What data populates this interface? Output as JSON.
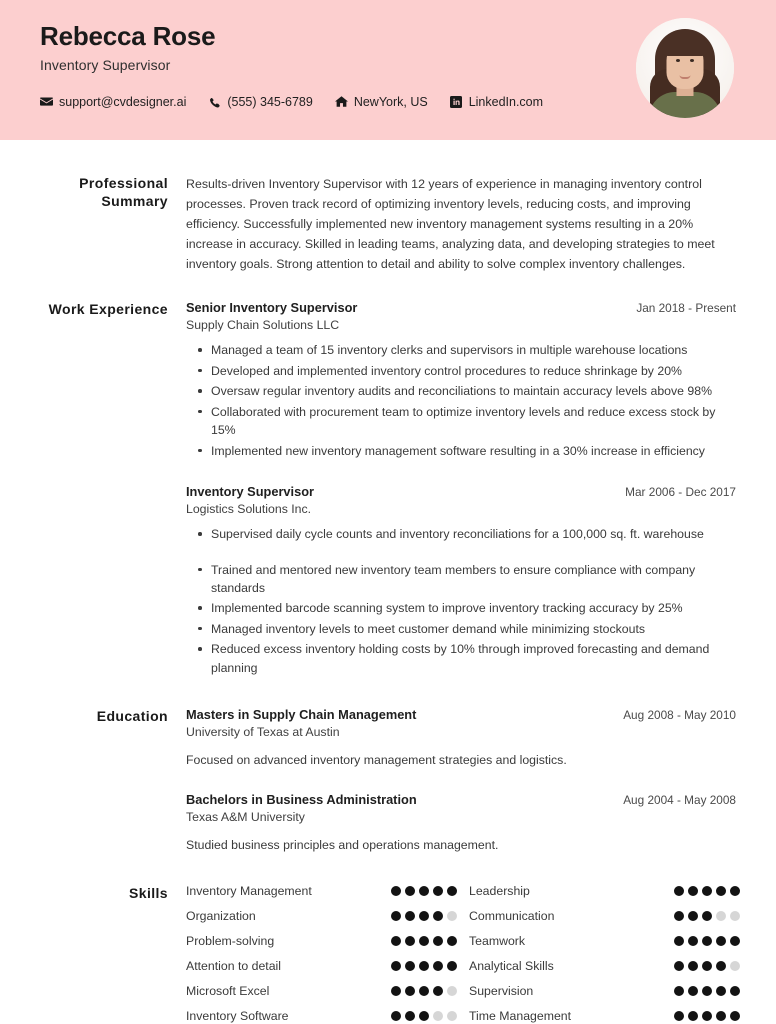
{
  "header": {
    "name": "Rebecca Rose",
    "job_title": "Inventory Supervisor",
    "background_color": "#FCCFCF",
    "avatar_alt": "profile-photo",
    "contacts": [
      {
        "icon": "envelope-icon",
        "text": "support@cvdesigner.ai"
      },
      {
        "icon": "phone-icon",
        "text": "(555) 345-6789"
      },
      {
        "icon": "home-icon",
        "text": "NewYork, US"
      },
      {
        "icon": "linkedin-icon",
        "text": "LinkedIn.com"
      }
    ]
  },
  "summary": {
    "label": "Professional Summary",
    "text": "Results-driven Inventory Supervisor with 12 years of experience in managing inventory control processes. Proven track record of optimizing inventory levels, reducing costs, and improving efficiency. Successfully implemented new inventory management systems resulting in a 20% increase in accuracy. Skilled in leading teams, analyzing data, and developing strategies to meet inventory goals. Strong attention to detail and ability to solve complex inventory challenges."
  },
  "experience": {
    "label": "Work Experience",
    "jobs": [
      {
        "role": "Senior Inventory Supervisor",
        "company": "Supply Chain Solutions LLC",
        "date": "Jan 2018 - Present",
        "bullets": [
          "Managed a team of 15 inventory clerks and supervisors in multiple warehouse locations",
          "Developed and implemented inventory control procedures to reduce shrinkage by 20%",
          "Oversaw regular inventory audits and reconciliations to maintain accuracy levels above 98%",
          "Collaborated with procurement team to optimize inventory levels and reduce excess stock by 15%",
          "Implemented new inventory management software resulting in a 30% increase in efficiency"
        ]
      },
      {
        "role": "Inventory Supervisor",
        "company": "Logistics Solutions Inc.",
        "date": "Mar 2006 - Dec 2017",
        "bullets": [
          "Supervised daily cycle counts and inventory reconciliations for a 100,000 sq. ft. warehouse",
          "Trained and mentored new inventory team members to ensure compliance with company standards",
          "Implemented barcode scanning system to improve inventory tracking accuracy by 25%",
          "Managed inventory levels to meet customer demand while minimizing stockouts",
          "Reduced excess inventory holding costs by 10% through improved forecasting and demand planning"
        ]
      }
    ]
  },
  "education": {
    "label": "Education",
    "items": [
      {
        "degree": "Masters in Supply Chain Management",
        "school": "University of Texas at Austin",
        "date": "Aug 2008 - May 2010",
        "description": "Focused on advanced inventory management strategies and logistics."
      },
      {
        "degree": "Bachelors in Business Administration",
        "school": "Texas A&M University",
        "date": "Aug 2004 - May 2008",
        "description": "Studied business principles and operations management."
      }
    ]
  },
  "skills": {
    "label": "Skills",
    "max_rating": 5,
    "left_column": [
      {
        "name": "Inventory Management",
        "rating": 5
      },
      {
        "name": "Organization",
        "rating": 4
      },
      {
        "name": "Problem-solving",
        "rating": 5
      },
      {
        "name": "Attention to detail",
        "rating": 5
      },
      {
        "name": "Microsoft Excel",
        "rating": 4
      },
      {
        "name": "Inventory Software",
        "rating": 3
      }
    ],
    "right_column": [
      {
        "name": "Leadership",
        "rating": 5
      },
      {
        "name": "Communication",
        "rating": 3
      },
      {
        "name": "Teamwork",
        "rating": 5
      },
      {
        "name": "Analytical Skills",
        "rating": 4
      },
      {
        "name": "Supervision",
        "rating": 5
      },
      {
        "name": "Time Management",
        "rating": 5
      }
    ]
  }
}
